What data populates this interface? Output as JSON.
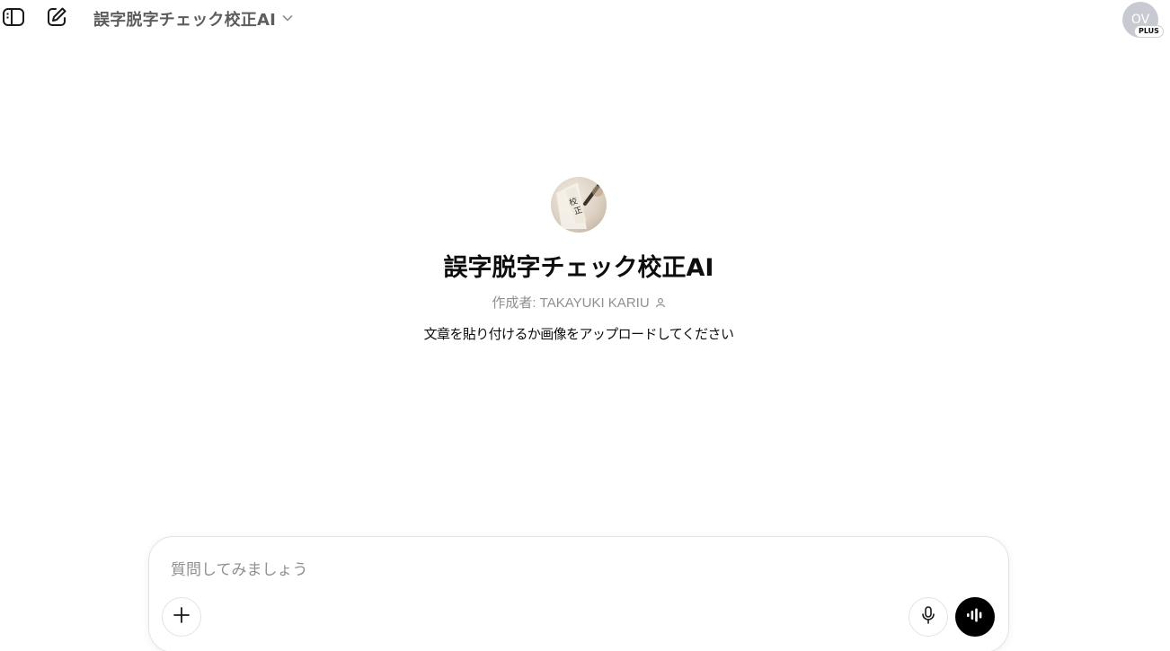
{
  "header": {
    "model_name": "誤字脱字チェック校正AI",
    "avatar_initials": "OV",
    "plan_badge": "PLUS",
    "icons": [
      "sidebar-icon",
      "edit-icon",
      "chevron-down-icon"
    ]
  },
  "gpt": {
    "title": "誤字脱字チェック校正AI",
    "author": "作成者: TAKAYUKI KARIU",
    "description": "文章を貼り付けるか画像をアップロードしてください"
  },
  "composer": {
    "placeholder": "質問してみましょう",
    "icons": [
      "plus-icon",
      "microphone-icon",
      "voice-mode-icon"
    ]
  },
  "colors": {
    "muted_text": "#8f8f8f",
    "avatar_bg": "#c7cbd1",
    "voice_button": "#000000",
    "border": "#e3e3e3"
  }
}
